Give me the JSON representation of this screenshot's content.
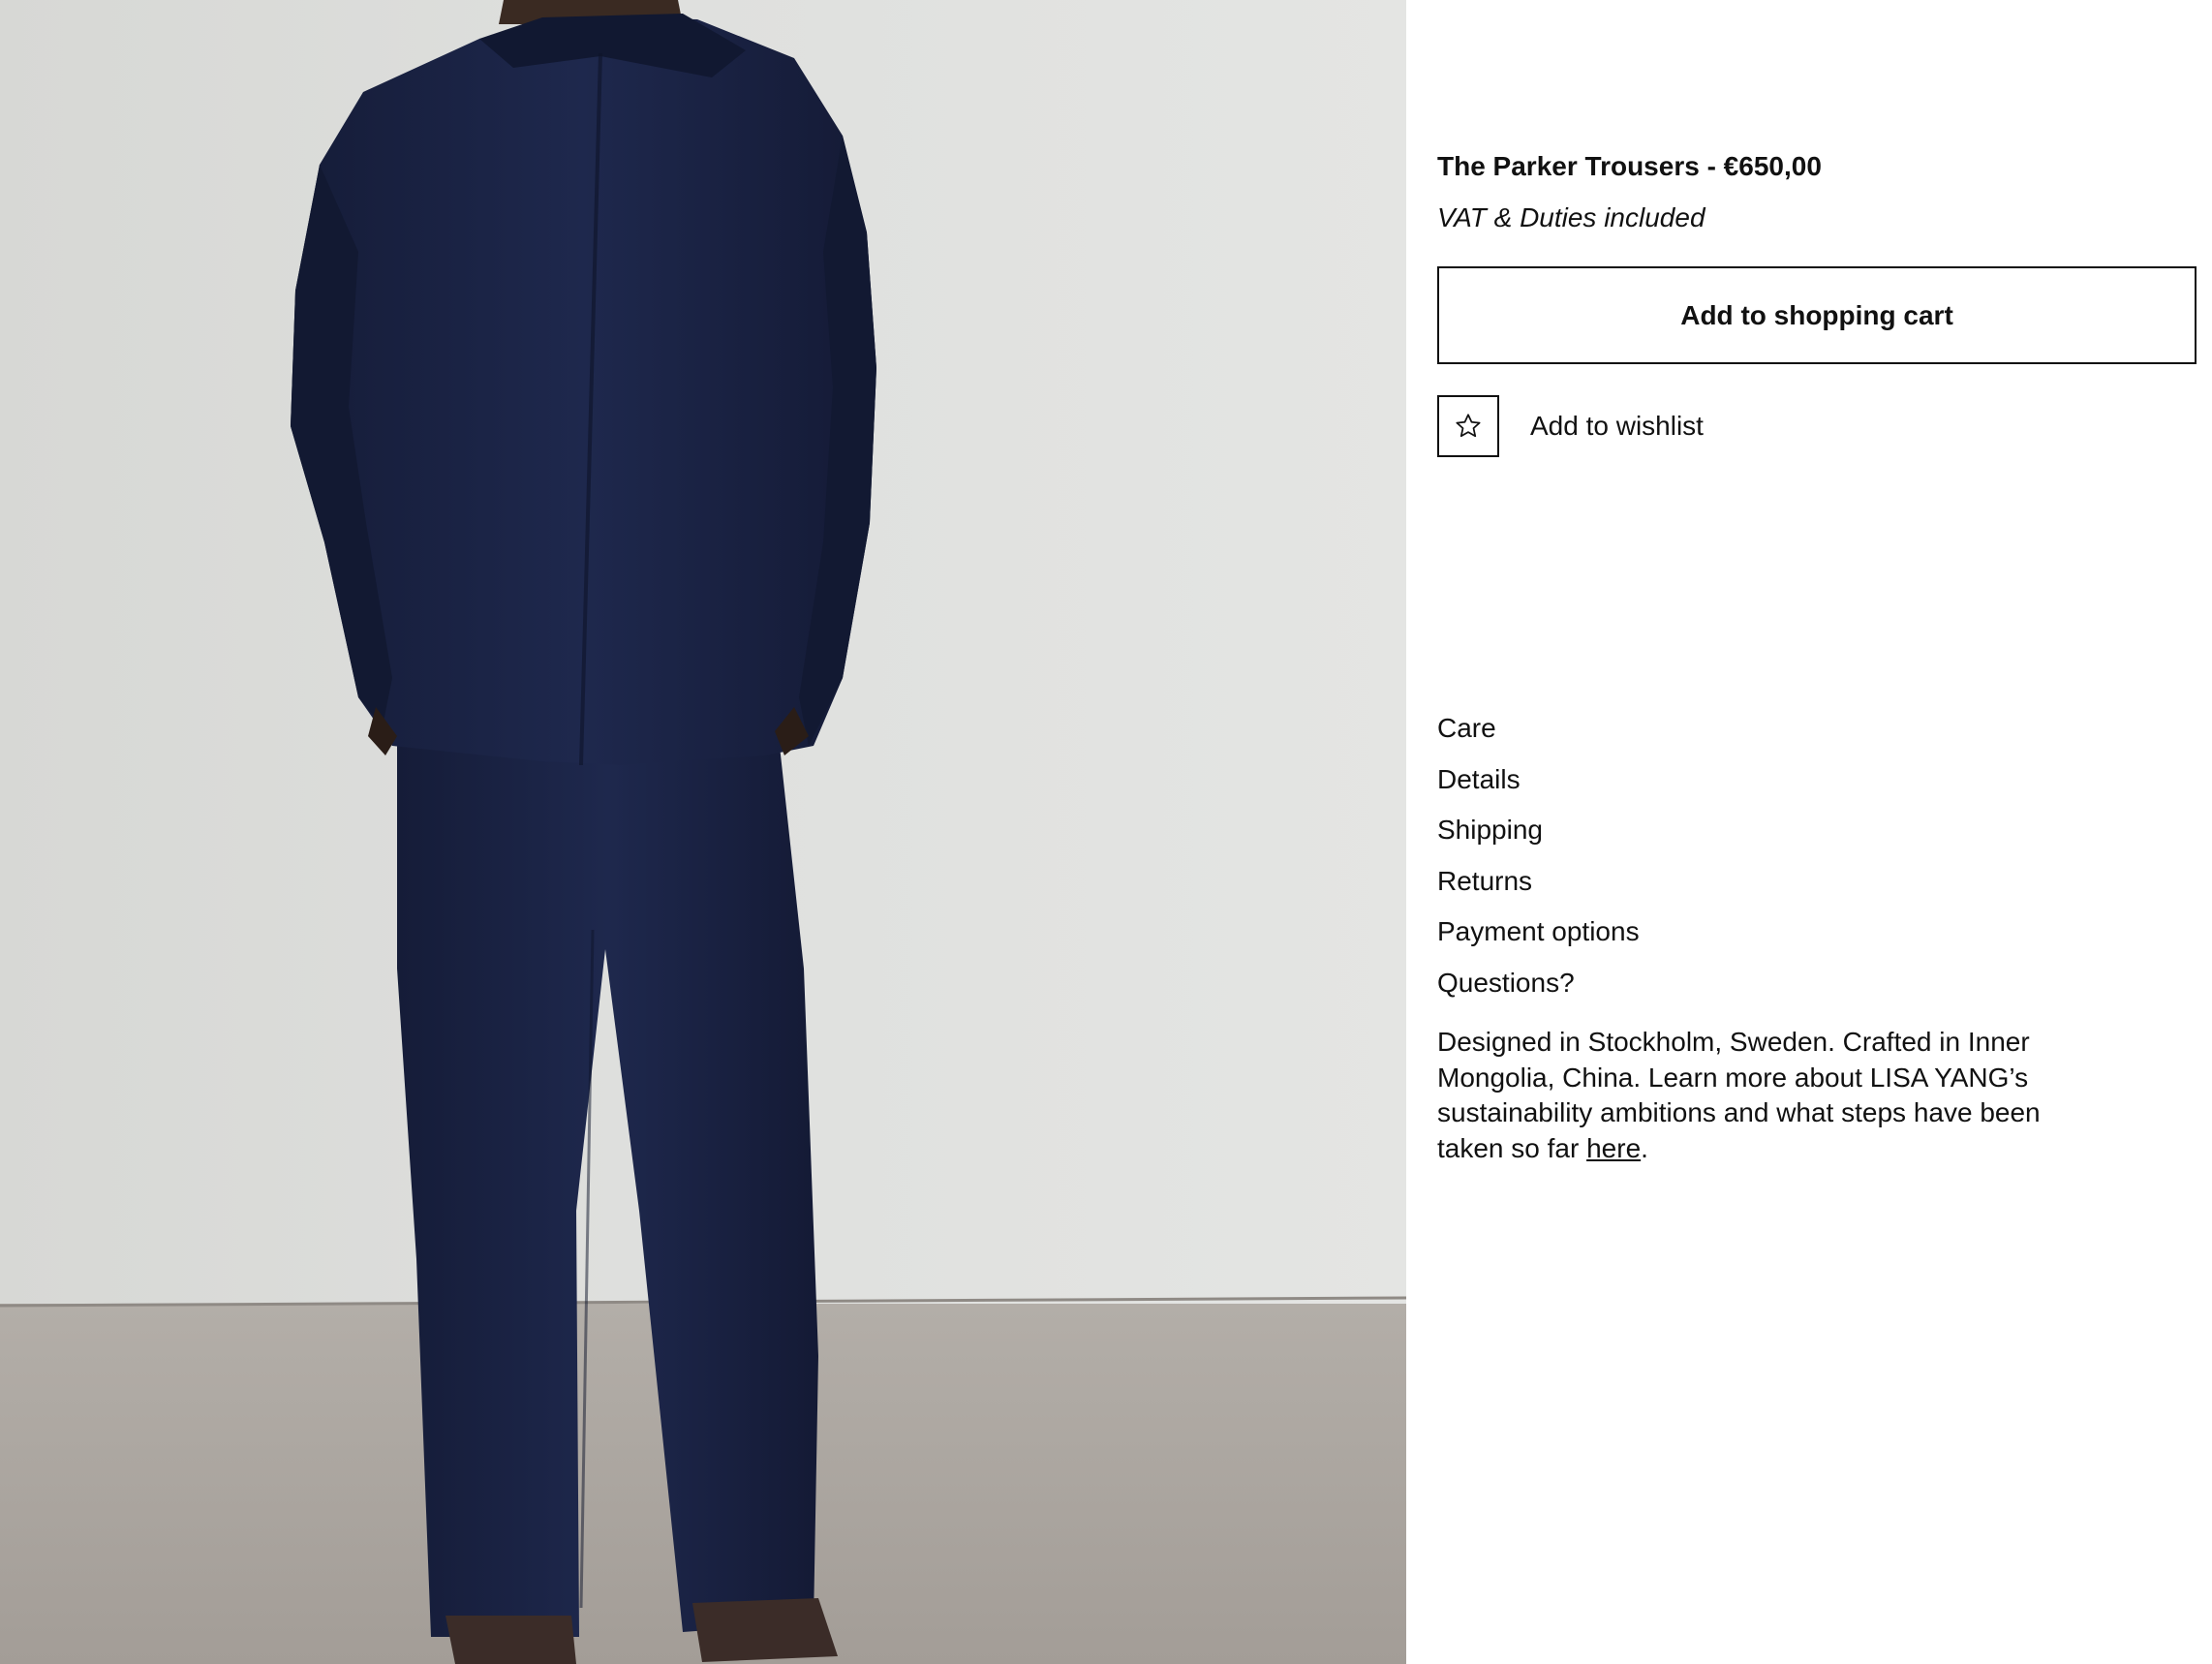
{
  "product": {
    "title": "The Parker Trousers - €650,00",
    "vat_note": "VAT & Duties included",
    "image_alt": "Model wearing navy jacket and trousers, back view"
  },
  "actions": {
    "add_to_cart_label": "Add to shopping cart",
    "wishlist_label": "Add to wishlist",
    "wishlist_icon": "star-outline-icon"
  },
  "accordion": {
    "items": [
      {
        "label": "Care"
      },
      {
        "label": "Details"
      },
      {
        "label": "Shipping"
      },
      {
        "label": "Returns"
      },
      {
        "label": "Payment options"
      },
      {
        "label": "Questions?"
      }
    ]
  },
  "about": {
    "text": "Designed in Stockholm, Sweden. Crafted in Inner Mongolia, China. Learn more about LISA YANG’s sustainability ambitions and what steps have been taken so far ",
    "link_label": "here",
    "trailing": "."
  },
  "colors": {
    "text": "#111111",
    "background": "#ffffff",
    "garment_navy": "#1b2446",
    "wall": "#dcdddb",
    "floor": "#a9a49e"
  }
}
